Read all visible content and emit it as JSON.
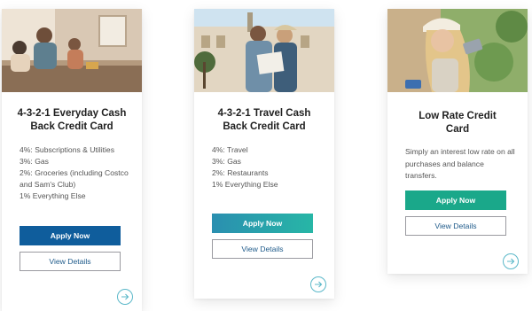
{
  "cards": [
    {
      "title": "4-3-2-1 Everyday Cash Back Credit Card",
      "features": [
        "4%: Subscriptions & Utilities",
        "3%: Gas",
        "2%: Groceries (including Costco and Sam's Club)",
        "1% Everything Else"
      ],
      "apply_label": "Apply Now",
      "details_label": "View Details",
      "arrow_icon": "arrow-right-icon"
    },
    {
      "title": "4-3-2-1 Travel Cash Back Credit Card",
      "features": [
        "4%: Travel",
        "3%: Gas",
        "2%: Restaurants",
        "1% Everything Else"
      ],
      "apply_label": "Apply Now",
      "details_label": "View Details",
      "arrow_icon": "arrow-right-icon"
    },
    {
      "title": "Low Rate Credit Card",
      "description": "Simply an interest low rate on all purchases and balance transfers.",
      "apply_label": "Apply Now",
      "details_label": "View Details",
      "arrow_icon": "arrow-right-icon"
    }
  ],
  "colors": {
    "card1_apply": "#0f5d9c",
    "card2_apply_gradient": [
      "#2a8fb0",
      "#27b6a6"
    ],
    "card3_apply": "#1aa88a",
    "details_text": "#1e5a8a",
    "arrow_border": "#5bb8c9"
  }
}
